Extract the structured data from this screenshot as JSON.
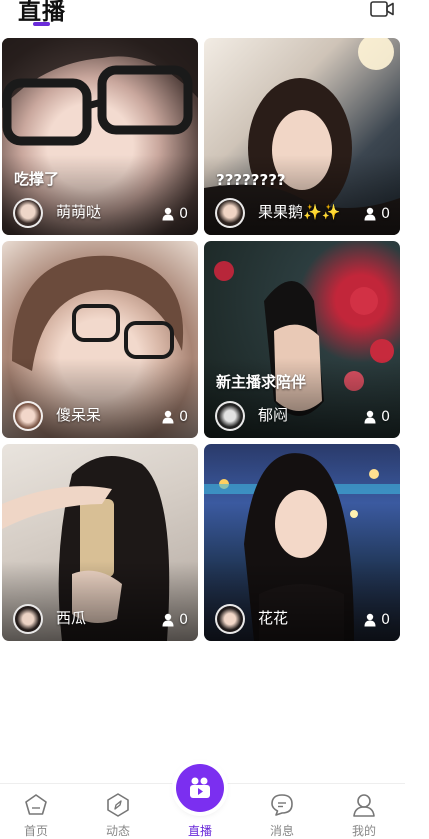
{
  "header": {
    "title": "直播",
    "video_icon": "video-camera-icon",
    "accent_color": "#6a2bd9"
  },
  "streams": [
    {
      "caption": "吃撑了",
      "name": "萌萌哒",
      "viewers": "0"
    },
    {
      "caption": "????????",
      "name": "果果鹅✨✨",
      "viewers": "0"
    },
    {
      "caption": "",
      "name": "傻呆呆",
      "viewers": "0"
    },
    {
      "caption": "新主播求陪伴",
      "name": "郁闷",
      "viewers": "0"
    },
    {
      "caption": "",
      "name": "西瓜",
      "viewers": "0"
    },
    {
      "caption": "",
      "name": "花花",
      "viewers": "0"
    }
  ],
  "tabbar": {
    "items": [
      {
        "label": "首页",
        "icon": "home-pentagon-icon"
      },
      {
        "label": "动态",
        "icon": "compass-icon"
      },
      {
        "label": "直播",
        "icon": "live-video-icon"
      },
      {
        "label": "消息",
        "icon": "chat-bubble-icon"
      },
      {
        "label": "我的",
        "icon": "profile-icon"
      }
    ],
    "active_color": "#6a2bd9"
  }
}
